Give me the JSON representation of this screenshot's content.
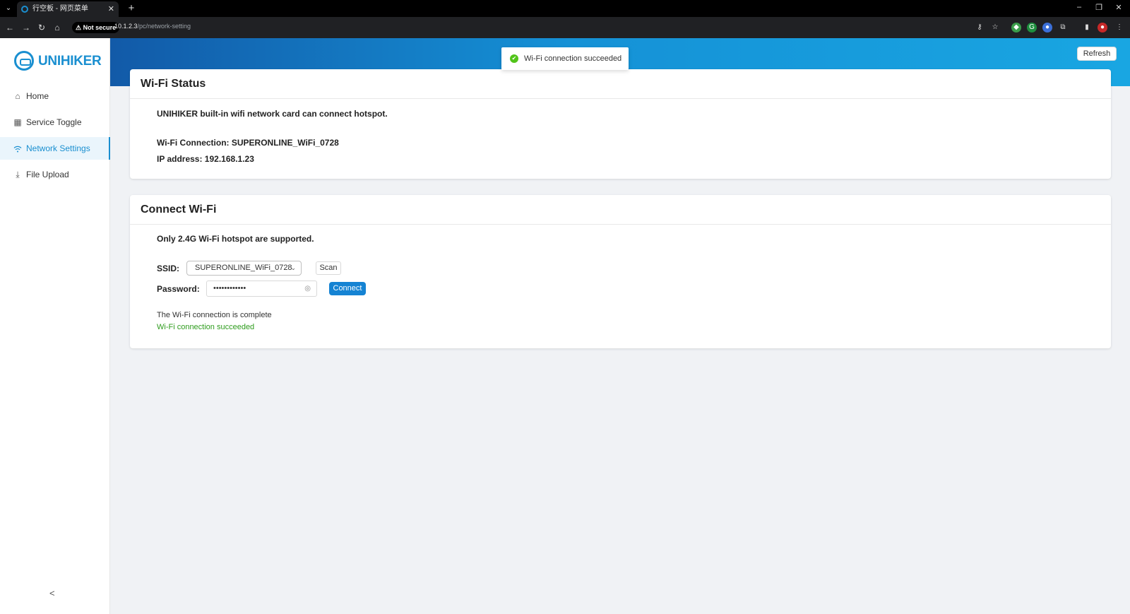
{
  "browser": {
    "tab_title": "行空板 - 网页菜单",
    "url_host": "10.1.2.3",
    "url_path": "/pc/network-setting",
    "security_label": "Not secure"
  },
  "sidebar": {
    "logo_text": "UNIHIKER",
    "items": [
      {
        "label": "Home",
        "icon": "home-icon"
      },
      {
        "label": "Service Toggle",
        "icon": "grid-icon"
      },
      {
        "label": "Network Settings",
        "icon": "wifi-icon"
      },
      {
        "label": "File Upload",
        "icon": "upload-icon"
      }
    ],
    "active_item": "Network Settings"
  },
  "header": {
    "refresh_label": "Refresh"
  },
  "toast": {
    "message": "Wi-Fi connection succeeded"
  },
  "wifi_status": {
    "title": "Wi-Fi Status",
    "description": "UNIHIKER built-in wifi network card can connect hotspot.",
    "connection": "Wi-Fi Connection: SUPERONLINE_WiFi_0728",
    "ip": "IP address: 192.168.1.23"
  },
  "connect_wifi": {
    "title": "Connect Wi-Fi",
    "note": "Only 2.4G Wi-Fi hotspot are supported.",
    "ssid_label": "SSID:",
    "ssid_value": "SUPERONLINE_WiFi_0728",
    "scan_label": "Scan",
    "password_label": "Password:",
    "password_value": "••••••••••••",
    "connect_label": "Connect",
    "status_text": "The Wi-Fi connection is complete",
    "status_result": "Wi-Fi connection succeeded"
  },
  "colors": {
    "accent": "#1a8fd0",
    "success": "#2e9c1d"
  }
}
